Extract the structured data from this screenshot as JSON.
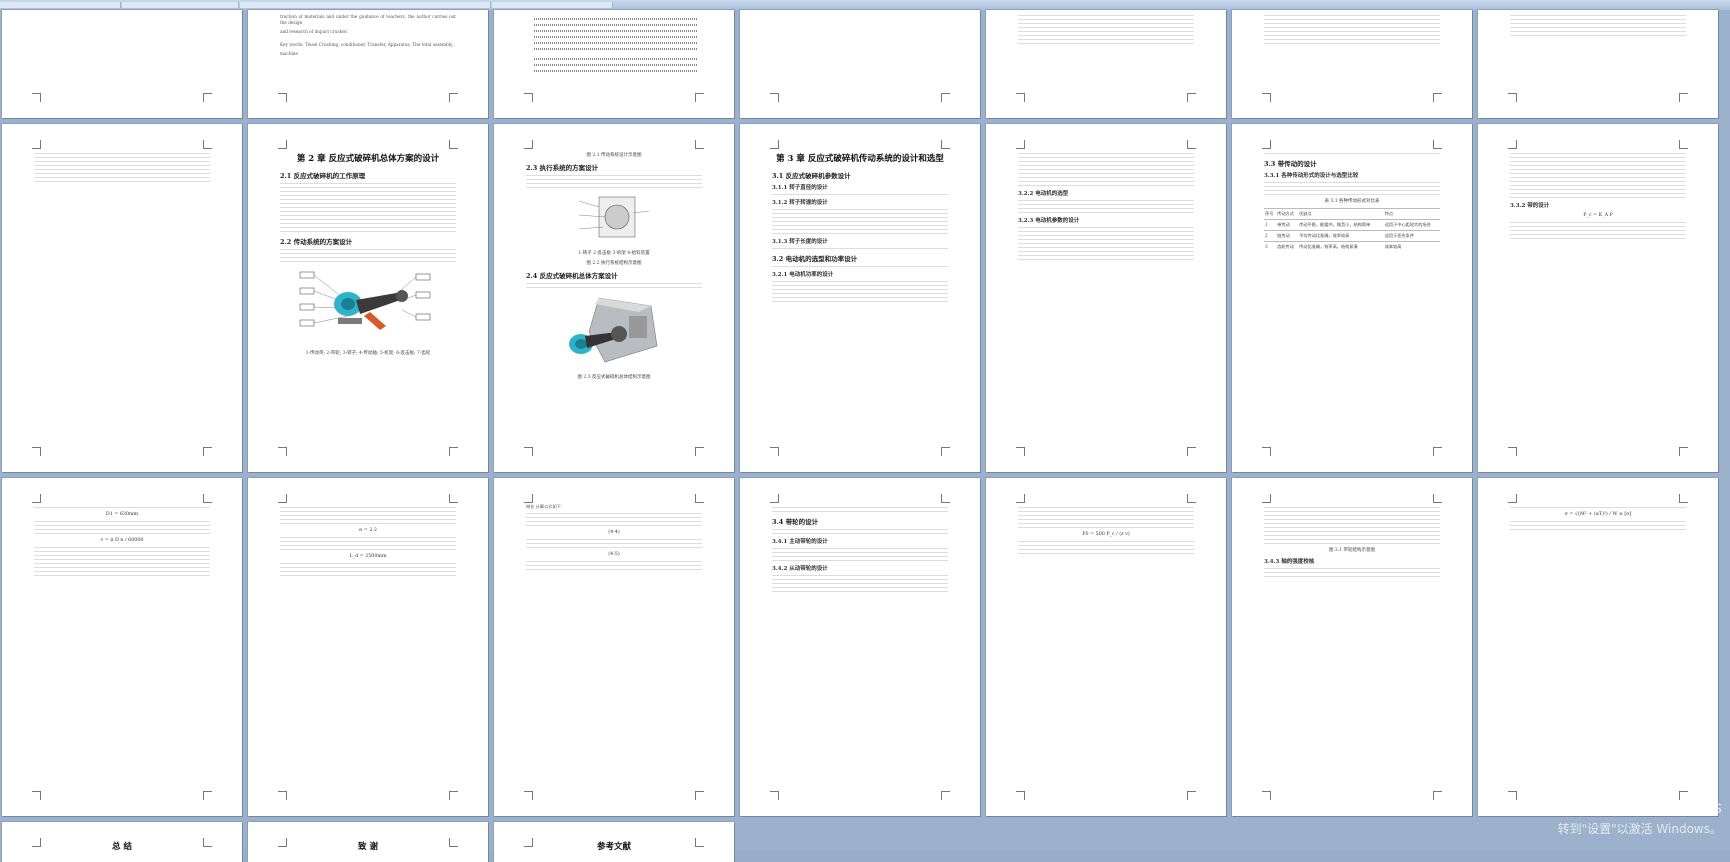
{
  "window": {
    "title_strip": ""
  },
  "pages": {
    "p_r0c1": {
      "lines": [
        "traction of materials and under the guidance of teachers, the author carries out the design",
        "and research of impact crusher.",
        "Key words: Tlesel Crushing, conditioner, Transfer, Apparatus, The total assembly,",
        "machine"
      ]
    },
    "p_r1c1": {
      "title": "第 2 章  反应式破碎机总体方案的设计",
      "s1": "2.1 反应式破碎机的工作原理",
      "s2": "2.2 传动系统的方案设计",
      "cap": "1-传动带; 2-带轮; 3-转子; 4-传动轴; 5-机架; 6-反击板; 7-齿轮"
    },
    "p_r1c2": {
      "cap_top": "图 2.1  传动系统设计示意图",
      "s1": "2.3 执行系统的方案设计",
      "cap_mid": "1-转子  2-反击板  3-机架  4-给料装置",
      "cap_mid2": "图 2.2  执行系统结构示意图",
      "s2": "2.4 反应式破碎机总体方案设计",
      "cap_bot": "图 2.3  反应式破碎机总体结构示意图"
    },
    "p_r1c3": {
      "title": "第 3 章  反应式破碎机传动系统的设计和选型",
      "s1": "3.1 反应式破碎机参数设计",
      "s2": "3.1.1 转子直径的设计",
      "s3": "3.1.2 转子转速的设计",
      "s4": "3.1.3 转子长度的设计",
      "s5": "3.2 电动机的选型和功率设计",
      "s6": "3.2.1 电动机功率的设计"
    },
    "p_r1c4": {
      "s1": "3.2.2 电动机的选型",
      "s2": "3.2.3 电动机参数的设计"
    },
    "p_r1c5": {
      "s1": "3.3 带传动的设计",
      "s2": "3.3.1 各种传动形式的设计与选型比较",
      "cap": "表 3.1  各种传动形式对比表",
      "tbl": [
        [
          "序号",
          "传动方式",
          "优缺点",
          "特点"
        ],
        [
          "1",
          "带传动",
          "传动平稳，能缓冲，噪音小，结构简单",
          "适用于中心距较大的场合"
        ],
        [
          "2",
          "链传动",
          "平均传动比准确，效率较高",
          "适用于恶劣条件"
        ],
        [
          "3",
          "齿轮传动",
          "传动比准确，效率高，结构紧凑",
          "成本较高"
        ]
      ]
    },
    "p_r1c6": {
      "s1": "3.3.2 带的设计",
      "f1": "P_c = K_A P"
    },
    "p_r2c0": {
      "f1": "D1 = 630mm",
      "f2": "v = π D n / 60000"
    },
    "p_r2c1": {
      "f1": "α = 2.2",
      "f2": "L_d = 2500mm"
    },
    "p_r2c2": {
      "head": "带长   计算公式如下：",
      "f1": "(4-4)",
      "f2": "(4-5)"
    },
    "p_r2c3": {
      "s1": "3.4 带轮的设计",
      "s2": "3.4.1 主动带轮的设计",
      "s3": "3.4.2 从动带轮的设计"
    },
    "p_r2c4": {
      "f1": "F0 = 500 P_c / (z v)"
    },
    "p_r2c5": {
      "cap": "图 3.1  带轮结构示意图",
      "s1": "3.4.3 轴的强度校核"
    },
    "p_r2c6": {
      "f1": "σ = √(M² + (αT)²) / W ≤ [σ]"
    },
    "p_r3c0": {
      "title": "总  结"
    },
    "p_r3c1": {
      "title": "致  谢"
    },
    "p_r3c2": {
      "title": "参考文献"
    }
  },
  "watermark": {
    "line1": "激活 Windows",
    "line2": "转到\"设置\"以激活 Windows。"
  }
}
